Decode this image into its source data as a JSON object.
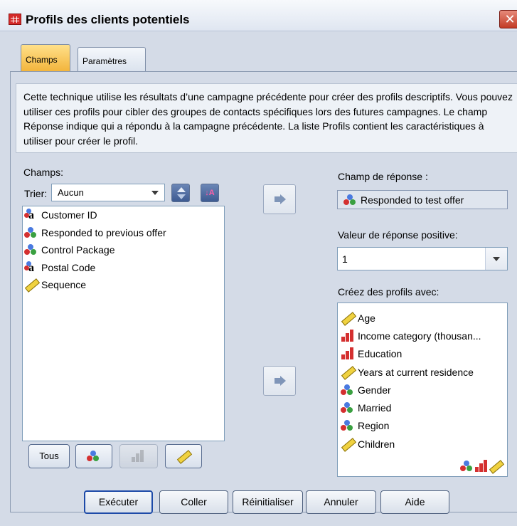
{
  "window": {
    "title": "Profils des clients potentiels",
    "close_glyph": "✕"
  },
  "tabs": [
    {
      "label": "Champs",
      "selected": true
    },
    {
      "label": "Paramètres",
      "selected": false
    }
  ],
  "description": "Cette technique utilise les résultats d’une campagne précédente pour créer des profils descriptifs. Vous pouvez utiliser ces profils pour cibler des groupes de contacts spécifiques lors des futures campagnes. Le champ Réponse indique qui a répondu à la campagne précédente. La liste Profils contient les caractéristiques à utiliser pour créer le profil.",
  "fields": {
    "label": "Champs:",
    "sort_label": "Trier:",
    "sort_value": "Aucun",
    "sort_alpha_glyph": "↓A",
    "items": [
      {
        "label": "Customer ID",
        "icon": "nominal-string-icon"
      },
      {
        "label": "Responded to previous offer",
        "icon": "nominal-icon"
      },
      {
        "label": "Control Package",
        "icon": "nominal-icon"
      },
      {
        "label": "Postal Code",
        "icon": "nominal-string-icon"
      },
      {
        "label": "Sequence",
        "icon": "scale-icon"
      }
    ],
    "filter_buttons": {
      "all": "Tous"
    }
  },
  "response": {
    "label": "Champ de réponse :",
    "value": "Responded to test offer"
  },
  "positive": {
    "label": "Valeur de réponse positive:",
    "value": "1"
  },
  "profiles": {
    "label": "Créez des profils avec:",
    "items": [
      {
        "label": "Age",
        "icon": "scale-icon"
      },
      {
        "label": "Income category (thousan...",
        "icon": "ordinal-icon"
      },
      {
        "label": "Education",
        "icon": "ordinal-icon"
      },
      {
        "label": "Years at current residence",
        "icon": "scale-icon"
      },
      {
        "label": "Gender",
        "icon": "nominal-icon"
      },
      {
        "label": "Married",
        "icon": "nominal-icon"
      },
      {
        "label": "Region",
        "icon": "nominal-icon"
      },
      {
        "label": "Children",
        "icon": "scale-icon"
      }
    ]
  },
  "buttons": {
    "run": "Exécuter",
    "paste": "Coller",
    "reset": "Réinitialiser",
    "cancel": "Annuler",
    "help": "Aide"
  },
  "colors": {
    "accent_tab": "#f3b53c",
    "panel": "#d4dbe7"
  }
}
